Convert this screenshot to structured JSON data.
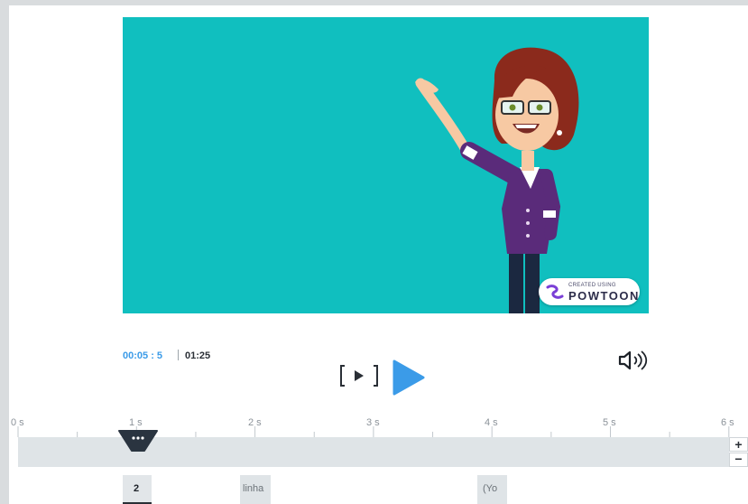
{
  "player": {
    "current_time": "00:05 : 5",
    "total_time": "01:25",
    "preview_button": "preview-scene-icon",
    "play_button": "play-icon",
    "volume_button": "volume-icon"
  },
  "watermark": {
    "small_text": "CREATED USING",
    "brand_text": "POWTOON"
  },
  "timeline": {
    "ticks": [
      "0 s",
      "1 s",
      "2 s",
      "3 s",
      "4 s",
      "5 s",
      "6 s"
    ],
    "zoom_in": "+",
    "zoom_out": "−",
    "markers": [
      "2",
      "linha",
      "(Yo"
    ]
  },
  "colors": {
    "video_bg": "#10bfbf",
    "accent_blue": "#3b9be8",
    "playhead": "#2a3440"
  }
}
